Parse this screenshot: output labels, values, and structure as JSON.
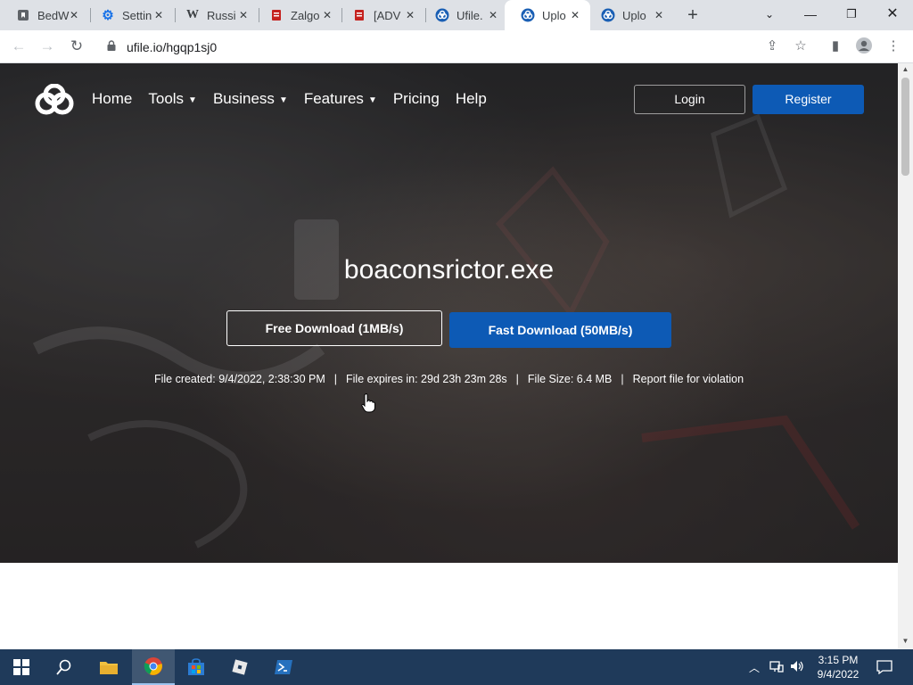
{
  "browser": {
    "tabs": [
      {
        "title": "BedW",
        "icon": "bookmark-icon",
        "active": false
      },
      {
        "title": "Settin",
        "icon": "gear-icon",
        "active": false
      },
      {
        "title": "Russi",
        "icon": "wikipedia-icon",
        "active": false
      },
      {
        "title": "Zalgo",
        "icon": "document-icon",
        "active": false
      },
      {
        "title": "[ADV",
        "icon": "document-icon",
        "active": false
      },
      {
        "title": "Ufile.",
        "icon": "ufile-icon",
        "active": false
      },
      {
        "title": "Uplo",
        "icon": "ufile-icon",
        "active": true
      },
      {
        "title": "Uplo",
        "icon": "ufile-icon",
        "active": false
      }
    ],
    "url": "ufile.io/hgqp1sj0"
  },
  "site": {
    "nav": [
      {
        "label": "Home",
        "dropdown": false
      },
      {
        "label": "Tools",
        "dropdown": true
      },
      {
        "label": "Business",
        "dropdown": true
      },
      {
        "label": "Features",
        "dropdown": true
      },
      {
        "label": "Pricing",
        "dropdown": false
      },
      {
        "label": "Help",
        "dropdown": false
      }
    ],
    "login_label": "Login",
    "register_label": "Register"
  },
  "file": {
    "name": "boaconsrictor.exe",
    "free_download_label": "Free Download (1MB/s)",
    "fast_download_label": "Fast Download (50MB/s)",
    "created": "File created: 9/4/2022, 2:38:30 PM",
    "expires": "File expires in: 29d 23h 23m 28s",
    "size": "File Size: 6.4 MB",
    "report_label": "Report file for violation",
    "separator": "|"
  },
  "taskbar": {
    "time": "3:15 PM",
    "date": "9/4/2022"
  },
  "colors": {
    "accent": "#0d5ab5",
    "taskbar": "#1f3a5a",
    "tabstrip": "#dee1e6"
  }
}
